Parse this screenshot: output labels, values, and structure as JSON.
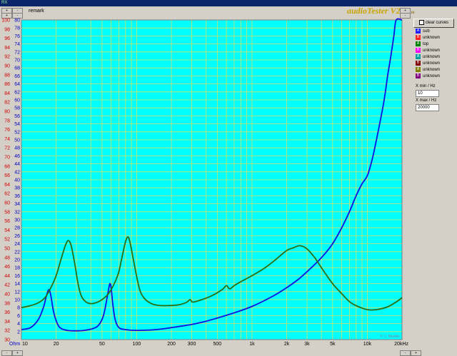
{
  "titlebar": {
    "text": "RX"
  },
  "header": {
    "remark": "remark",
    "logo": "audioTester V2.2",
    "version": "0.16"
  },
  "spinners": {
    "up": "+",
    "down": "-"
  },
  "credit": "© U. Mueller",
  "panel": {
    "clear_label": "clear curves",
    "curves": [
      {
        "letter": "A",
        "name": "sub",
        "color": "#2020ff"
      },
      {
        "letter": "B",
        "name": "unknown",
        "color": "#ff2020"
      },
      {
        "letter": "A",
        "name": "top",
        "color": "#008000"
      },
      {
        "letter": "B",
        "name": "unknown",
        "color": "#ff00ff"
      },
      {
        "letter": "A",
        "name": "unknown",
        "color": "#00a0a0"
      },
      {
        "letter": "B",
        "name": "unknown",
        "color": "#800000"
      },
      {
        "letter": "A",
        "name": "unknown",
        "color": "#808000"
      },
      {
        "letter": "B",
        "name": "unknown",
        "color": "#800080"
      }
    ],
    "xmin_label": "X min / Hz",
    "xmin_value": "10",
    "xmax_label": "X max / Hz",
    "xmax_value": "20000"
  },
  "chart_data": {
    "type": "line",
    "xscale": "log",
    "xlim": [
      10,
      20000
    ],
    "x_tick_labels": [
      {
        "v": 10,
        "t": "10"
      },
      {
        "v": 20,
        "t": "20"
      },
      {
        "v": 50,
        "t": "50"
      },
      {
        "v": 100,
        "t": "100"
      },
      {
        "v": 200,
        "t": "200"
      },
      {
        "v": 300,
        "t": "300"
      },
      {
        "v": 500,
        "t": "500"
      },
      {
        "v": 1000,
        "t": "1k"
      },
      {
        "v": 2000,
        "t": "2k"
      },
      {
        "v": 3000,
        "t": "3k"
      },
      {
        "v": 5000,
        "t": "5k"
      },
      {
        "v": 10000,
        "t": "10k"
      },
      {
        "v": 20000,
        "t": "20kHz"
      }
    ],
    "x_unit_label": "Ohm",
    "y_left_ticks": [
      "30",
      "32",
      "34",
      "36",
      "38",
      "40",
      "42",
      "44",
      "46",
      "48",
      "50",
      "52",
      "54",
      "56",
      "58",
      "60",
      "62",
      "64",
      "66",
      "68",
      "70",
      "72",
      "74",
      "76",
      "78",
      "80",
      "82",
      "84",
      "86",
      "88",
      "90",
      "92",
      "94",
      "96",
      "98",
      "100"
    ],
    "y_left_lim": [
      30,
      100
    ],
    "y_right_ticks": [
      "2",
      "4",
      "6",
      "8",
      "10",
      "12",
      "14",
      "16",
      "18",
      "20",
      "22",
      "24",
      "26",
      "28",
      "30",
      "32",
      "34",
      "36",
      "38",
      "40",
      "42",
      "44",
      "46",
      "48",
      "50",
      "52",
      "54",
      "56",
      "58",
      "60",
      "62",
      "64",
      "66",
      "68",
      "70",
      "72",
      "74",
      "76",
      "78",
      "80"
    ],
    "y_right_lim": [
      0,
      80
    ],
    "grid": true,
    "series": [
      {
        "name": "sub",
        "color": "#1010e0",
        "axis": "right",
        "points": [
          [
            10,
            2.5
          ],
          [
            12,
            3
          ],
          [
            14,
            5
          ],
          [
            15.5,
            8
          ],
          [
            16.5,
            11
          ],
          [
            17.3,
            12.5
          ],
          [
            18,
            11
          ],
          [
            19,
            7
          ],
          [
            20.5,
            4
          ],
          [
            22,
            2.8
          ],
          [
            25,
            2.3
          ],
          [
            30,
            2.2
          ],
          [
            35,
            2.3
          ],
          [
            40,
            2.6
          ],
          [
            45,
            3.2
          ],
          [
            49,
            4.5
          ],
          [
            52,
            6.5
          ],
          [
            55,
            10
          ],
          [
            57,
            12.5
          ],
          [
            58.5,
            14
          ],
          [
            60,
            13
          ],
          [
            62,
            9
          ],
          [
            65,
            5
          ],
          [
            70,
            3
          ],
          [
            80,
            2.5
          ],
          [
            100,
            2.3
          ],
          [
            130,
            2.4
          ],
          [
            160,
            2.6
          ],
          [
            200,
            3
          ],
          [
            300,
            3.8
          ],
          [
            400,
            4.6
          ],
          [
            500,
            5.4
          ],
          [
            700,
            6.7
          ],
          [
            1000,
            8.3
          ],
          [
            1500,
            10.8
          ],
          [
            2000,
            13
          ],
          [
            2500,
            15
          ],
          [
            3000,
            17
          ],
          [
            4000,
            20.5
          ],
          [
            5000,
            24
          ],
          [
            6000,
            28
          ],
          [
            7000,
            32
          ],
          [
            8000,
            36
          ],
          [
            9000,
            39
          ],
          [
            10000,
            41
          ],
          [
            11000,
            45
          ],
          [
            12000,
            50
          ],
          [
            13000,
            55
          ],
          [
            14000,
            60
          ],
          [
            15000,
            66
          ],
          [
            16000,
            71
          ],
          [
            17000,
            76
          ],
          [
            17800,
            80
          ],
          [
            20000,
            80
          ]
        ]
      },
      {
        "name": "top",
        "color": "#2a6e10",
        "axis": "right",
        "points": [
          [
            10,
            8
          ],
          [
            12,
            8.5
          ],
          [
            14,
            9.2
          ],
          [
            16,
            10.5
          ],
          [
            18,
            13
          ],
          [
            20,
            16
          ],
          [
            22,
            20
          ],
          [
            24,
            23.5
          ],
          [
            25.5,
            24.8
          ],
          [
            27,
            23.5
          ],
          [
            29,
            19
          ],
          [
            31,
            14
          ],
          [
            33,
            11
          ],
          [
            36,
            9.5
          ],
          [
            40,
            9
          ],
          [
            45,
            9.3
          ],
          [
            50,
            10
          ],
          [
            55,
            11
          ],
          [
            60,
            12.5
          ],
          [
            65,
            14.5
          ],
          [
            70,
            17
          ],
          [
            75,
            21
          ],
          [
            80,
            24.5
          ],
          [
            84,
            25.7
          ],
          [
            88,
            24
          ],
          [
            95,
            19
          ],
          [
            105,
            13
          ],
          [
            115,
            10.5
          ],
          [
            130,
            9.2
          ],
          [
            150,
            8.6
          ],
          [
            180,
            8.5
          ],
          [
            230,
            8.7
          ],
          [
            270,
            9.3
          ],
          [
            290,
            10
          ],
          [
            305,
            9.4
          ],
          [
            350,
            9.8
          ],
          [
            450,
            11
          ],
          [
            550,
            12.5
          ],
          [
            600,
            13.5
          ],
          [
            640,
            12.7
          ],
          [
            700,
            13.5
          ],
          [
            800,
            14.5
          ],
          [
            1000,
            16
          ],
          [
            1300,
            18
          ],
          [
            1600,
            20
          ],
          [
            2000,
            22.3
          ],
          [
            2300,
            23
          ],
          [
            2600,
            23.5
          ],
          [
            3000,
            22.7
          ],
          [
            3500,
            20.5
          ],
          [
            4000,
            18
          ],
          [
            5000,
            14
          ],
          [
            6000,
            11.5
          ],
          [
            7000,
            9.5
          ],
          [
            8000,
            8.5
          ],
          [
            10000,
            7.5
          ],
          [
            12000,
            7.5
          ],
          [
            15000,
            8.2
          ],
          [
            18000,
            9.5
          ],
          [
            20000,
            10.5
          ]
        ]
      }
    ]
  }
}
